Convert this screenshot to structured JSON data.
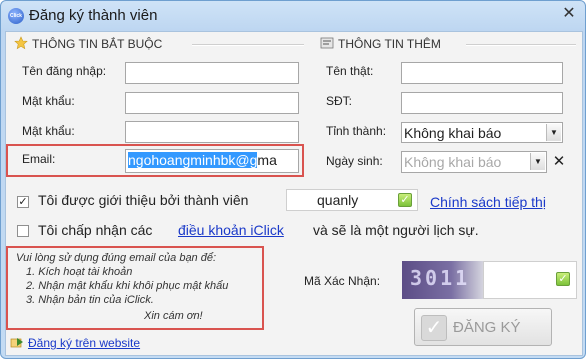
{
  "window": {
    "title": "Đăng ký thành viên",
    "icon_text": "Click",
    "close": "✕"
  },
  "required": {
    "title": "THÔNG TIN BẮT BUỘC",
    "username_label": "Tên đăng nhập:",
    "password_label": "Mật khẩu:",
    "password2_label": "Mật khẩu:",
    "email_label": "Email:",
    "email_value": "ngohoangminhbk@gma",
    "email_selected": "ngohoangminhbk@g"
  },
  "extra": {
    "title": "THÔNG TIN THÊM",
    "realname_label": "Tên thật:",
    "phone_label": "SĐT:",
    "province_label": "Tỉnh thành:",
    "province_value": "Không khai báo",
    "birthday_label": "Ngày sinh:",
    "birthday_value": "Không khai báo",
    "clear_icon": "✕"
  },
  "referral": {
    "label": "Tôi được giới thiệu bởi thành viên",
    "value": "quanly",
    "policy_link": "Chính sách tiếp thị",
    "checked": true
  },
  "terms": {
    "prefix": "Tôi chấp nhận các",
    "link": "điều khoản iClick",
    "suffix": "và sẽ là một người lịch sự.",
    "checked": false
  },
  "notice": {
    "lines": [
      "Vui lòng sử dụng đúng email của bạn để:",
      "1. Kích hoạt tài khoản",
      "2. Nhận mật khẩu khi khôi phục mật khẩu",
      "3. Nhận bản tin của iClick."
    ],
    "thanks": "Xin cám ơn!"
  },
  "captcha": {
    "label": "Mã Xác Nhận:",
    "image_text": "3011"
  },
  "register_button": "ĐĂNG KÝ",
  "website_link": "Đăng ký trên website",
  "colors": {
    "highlight": "#d9534f",
    "selection": "#3399ff",
    "link": "#1a39c9"
  }
}
